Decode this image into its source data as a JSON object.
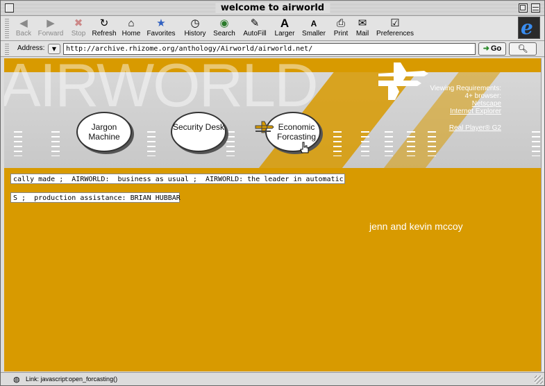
{
  "window": {
    "title": "welcome to airworld"
  },
  "toolbar": {
    "buttons": [
      {
        "label": "Back",
        "icon": "back-arrow-icon",
        "glyph": "◀",
        "enabled": false
      },
      {
        "label": "Forward",
        "icon": "forward-arrow-icon",
        "glyph": "▶",
        "enabled": false
      },
      {
        "label": "Stop",
        "icon": "stop-icon",
        "glyph": "✖",
        "enabled": false
      },
      {
        "label": "Refresh",
        "icon": "refresh-icon",
        "glyph": "↻",
        "enabled": true
      },
      {
        "label": "Home",
        "icon": "home-icon",
        "glyph": "⌂",
        "enabled": true
      },
      {
        "label": "Favorites",
        "icon": "favorites-icon",
        "glyph": "★",
        "enabled": true
      },
      {
        "label": "History",
        "icon": "history-icon",
        "glyph": "◷",
        "enabled": true
      },
      {
        "label": "Search",
        "icon": "search-icon",
        "glyph": "◉",
        "enabled": true
      },
      {
        "label": "AutoFill",
        "icon": "autofill-icon",
        "glyph": "✎",
        "enabled": true
      },
      {
        "label": "Larger",
        "icon": "larger-text-icon",
        "glyph": "A",
        "enabled": true
      },
      {
        "label": "Smaller",
        "icon": "smaller-text-icon",
        "glyph": "A",
        "enabled": true
      },
      {
        "label": "Print",
        "icon": "print-icon",
        "glyph": "⎙",
        "enabled": true
      },
      {
        "label": "Mail",
        "icon": "mail-icon",
        "glyph": "✉",
        "enabled": true
      },
      {
        "label": "Preferences",
        "icon": "preferences-icon",
        "glyph": "☑",
        "enabled": true
      }
    ]
  },
  "address": {
    "label": "Address:",
    "url": "http://archive.rhizome.org/anthology/Airworld/airworld.net/",
    "go_label": "Go"
  },
  "page": {
    "banner_word": "AIRWORLD",
    "nav": {
      "jargon": "Jargon Machine",
      "security": "Security Desk",
      "economic": "Economic Forcasting"
    },
    "requirements": {
      "heading": "Viewing Requirements:",
      "browser_line": "4+ browser:",
      "netscape": "Netscape",
      "ie": "Internet Explorer",
      "realplayer": "Real Player® G2"
    },
    "ticker1": "cally made ;  AIRWORLD:  business as usual ;  AIRWORLD: the leader in automatic",
    "ticker2": "S ;  production assistance: BRIAN HUBBAR",
    "credits": "jenn and kevin mccoy"
  },
  "status": {
    "message": "Link: javascript:open_forcasting()"
  },
  "colors": {
    "page_background": "#d89a00",
    "banner_gray": "#d0d0d0"
  }
}
